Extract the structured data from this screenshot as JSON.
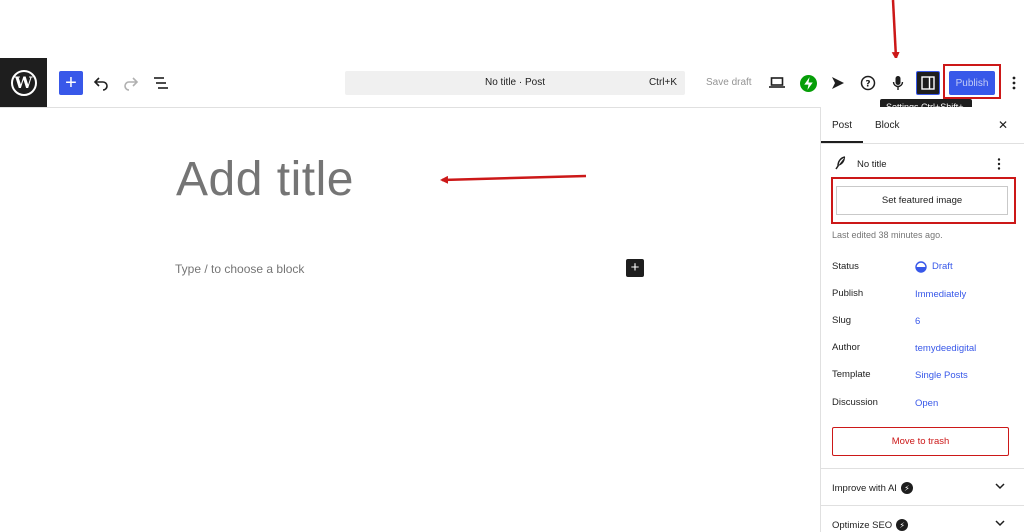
{
  "toolbar": {
    "logo_glyph": "W",
    "add_block_glyph": "+",
    "command_bar_title": "No title · Post",
    "command_bar_shortcut": "Ctrl+K",
    "save_draft": "Save draft",
    "publish": "Publish",
    "tooltip": "Settings  Ctrl+Shift+,"
  },
  "editor": {
    "title_placeholder": "Add title",
    "block_placeholder": "Type / to choose a block",
    "inline_add_glyph": "+"
  },
  "sidebar": {
    "tabs": [
      "Post",
      "Block"
    ],
    "close_glyph": "✕",
    "post_title": "No title",
    "featured_image_button": "Set featured image",
    "last_edited": "Last edited 38 minutes ago.",
    "rows": [
      {
        "label": "Status",
        "value": "Draft"
      },
      {
        "label": "Publish",
        "value": "Immediately"
      },
      {
        "label": "Slug",
        "value": "6"
      },
      {
        "label": "Author",
        "value": "temydeedigital"
      },
      {
        "label": "Template",
        "value": "Single Posts"
      },
      {
        "label": "Discussion",
        "value": "Open"
      }
    ],
    "trash_button": "Move to trash",
    "panels": [
      "Improve with AI",
      "Optimize SEO"
    ]
  },
  "colors": {
    "accent": "#3858e9",
    "annotation_red": "#cc1818",
    "jetpack_green": "#069e08"
  },
  "icons": [
    "wordpress-logo-icon",
    "undo-icon",
    "redo-icon",
    "document-overview-icon",
    "preview-device-icon",
    "jetpack-icon",
    "send-icon",
    "help-icon",
    "microphone-icon",
    "settings-sidebar-icon",
    "more-options-icon",
    "feather-icon",
    "bolt-icon",
    "chevron-down-icon",
    "close-icon"
  ]
}
